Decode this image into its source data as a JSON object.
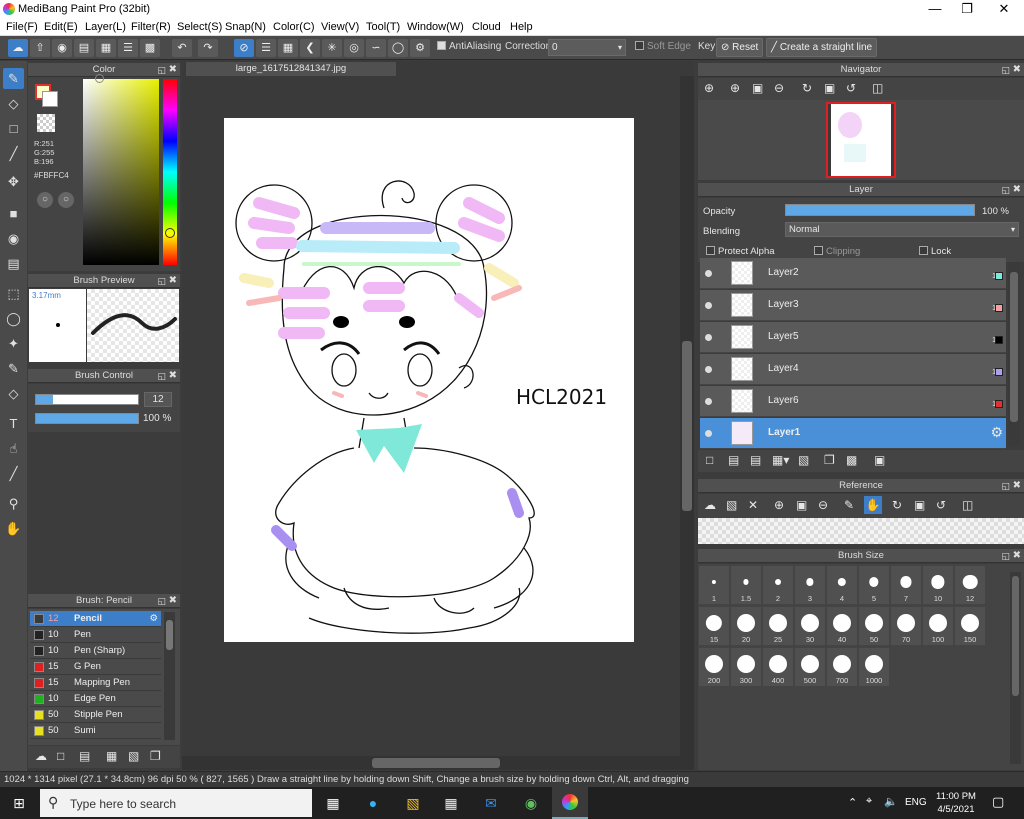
{
  "window": {
    "title": "MediBang Paint Pro (32bit)"
  },
  "menu": [
    "File(F)",
    "Edit(E)",
    "Layer(L)",
    "Filter(R)",
    "Select(S)",
    "Snap(N)",
    "Color(C)",
    "View(V)",
    "Tool(T)",
    "Window(W)",
    "Cloud",
    "Help"
  ],
  "toolbar": {
    "antialiasing": "AntiAliasing",
    "correction_label": "Correction",
    "correction_value": "0",
    "soft_edge": "Soft Edge",
    "key": "Key",
    "reset": "Reset",
    "straight_line": "Create a straight line"
  },
  "color_panel": {
    "title": "Color",
    "r": "R:251",
    "g": "G:255",
    "b": "B:196",
    "hex": "#FBFFC4",
    "fg": "#FBFFC4"
  },
  "brush_preview": {
    "title": "Brush Preview",
    "size": "3.17mm"
  },
  "brush_control": {
    "title": "Brush Control",
    "size": "12",
    "opacity": "100 %",
    "size_fraction": 0.17,
    "opacity_fraction": 1.0
  },
  "brush_list": {
    "title": "Brush: Pencil",
    "items": [
      {
        "n": "12",
        "label": "Pencil",
        "color": "#3a3a3a"
      },
      {
        "n": "10",
        "label": "Pen",
        "color": "#222222"
      },
      {
        "n": "10",
        "label": "Pen (Sharp)",
        "color": "#222222"
      },
      {
        "n": "15",
        "label": "G Pen",
        "color": "#e02020"
      },
      {
        "n": "15",
        "label": "Mapping Pen",
        "color": "#e02020"
      },
      {
        "n": "10",
        "label": "Edge Pen",
        "color": "#20b020"
      },
      {
        "n": "50",
        "label": "Stipple Pen",
        "color": "#e8e020"
      },
      {
        "n": "50",
        "label": "Sumi",
        "color": "#e8e020"
      }
    ]
  },
  "canvas": {
    "tab": "large_1617512841347.jpg",
    "signature": "HCL2021"
  },
  "navigator": {
    "title": "Navigator"
  },
  "layer_panel": {
    "title": "Layer",
    "opacity_label": "Opacity",
    "opacity_value": "100 %",
    "blending_label": "Blending",
    "blending_value": "Normal",
    "protect_alpha": "Protect Alpha",
    "clipping": "Clipping",
    "lock": "Lock",
    "layers": [
      {
        "name": "Layer2",
        "color": "#7fe8d8"
      },
      {
        "name": "Layer3",
        "color": "#f4a0a0"
      },
      {
        "name": "Layer5",
        "color": "#000000"
      },
      {
        "name": "Layer4",
        "color": "#a9a0f0"
      },
      {
        "name": "Layer6",
        "color": "#e03030"
      },
      {
        "name": "Layer1",
        "color": ""
      }
    ]
  },
  "reference": {
    "title": "Reference"
  },
  "brush_size": {
    "title": "Brush Size",
    "sizes": [
      "1",
      "1.5",
      "2",
      "3",
      "4",
      "5",
      "7",
      "10",
      "12",
      "15",
      "20",
      "25",
      "30",
      "40",
      "50",
      "70",
      "100",
      "150",
      "200",
      "300",
      "400",
      "500",
      "700",
      "1000"
    ]
  },
  "status": {
    "text": "1024 * 1314 pixel   (27.1 * 34.8cm)   96 dpi   50 %   ( 827, 1565 )   Draw a straight line by holding down Shift, Change a brush size by holding down Ctrl, Alt, and dragging"
  },
  "taskbar": {
    "search": "Type here to search",
    "lang": "ENG",
    "time": "11:00 PM",
    "date": "4/5/2021"
  }
}
